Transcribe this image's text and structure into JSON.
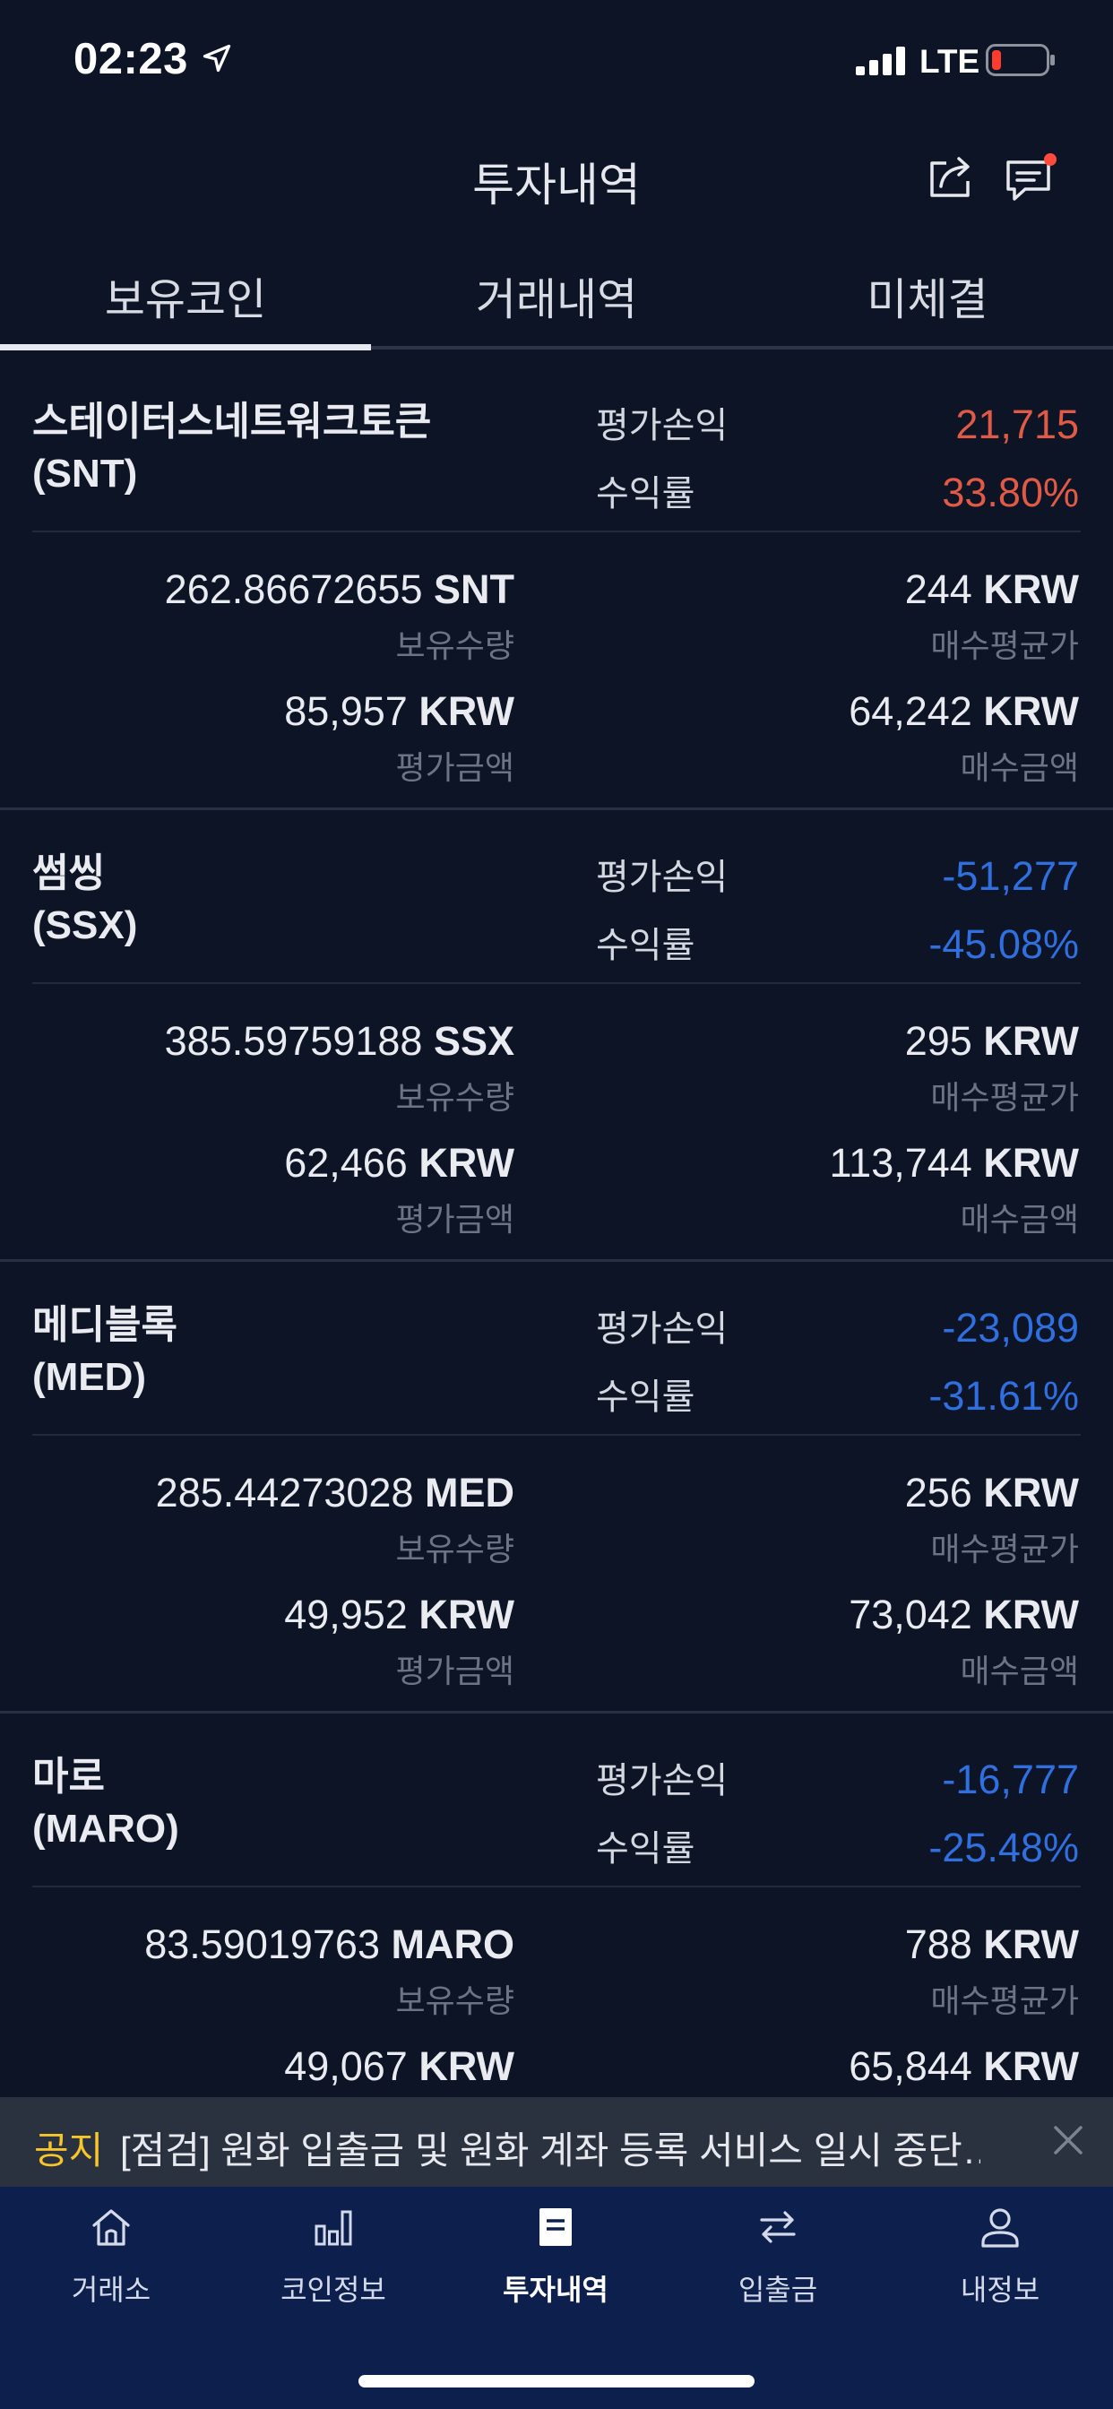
{
  "status": {
    "time": "02:23",
    "network": "LTE"
  },
  "header": {
    "title": "투자내역"
  },
  "tabs": [
    "보유코인",
    "거래내역",
    "미체결"
  ],
  "labels": {
    "pl": "평가손익",
    "rate": "수익률",
    "holdings": "보유수량",
    "avg_price": "매수평균가",
    "eval_amount": "평가금액",
    "buy_amount": "매수금액"
  },
  "coins": [
    {
      "name": "스테이터스네트워크토큰",
      "symbol": "(SNT)",
      "pl": "21,715",
      "rate": "33.80%",
      "qty": "262.86672655",
      "qty_unit": "SNT",
      "avg": "244",
      "avg_unit": "KRW",
      "eval": "85,957",
      "eval_unit": "KRW",
      "buy": "64,242",
      "buy_unit": "KRW"
    },
    {
      "name": "썸씽",
      "symbol": "(SSX)",
      "pl": "-51,277",
      "rate": "-45.08%",
      "qty": "385.59759188",
      "qty_unit": "SSX",
      "avg": "295",
      "avg_unit": "KRW",
      "eval": "62,466",
      "eval_unit": "KRW",
      "buy": "113,744",
      "buy_unit": "KRW"
    },
    {
      "name": "메디블록",
      "symbol": "(MED)",
      "pl": "-23,089",
      "rate": "-31.61%",
      "qty": "285.44273028",
      "qty_unit": "MED",
      "avg": "256",
      "avg_unit": "KRW",
      "eval": "49,952",
      "eval_unit": "KRW",
      "buy": "73,042",
      "buy_unit": "KRW"
    },
    {
      "name": "마로",
      "symbol": "(MARO)",
      "pl": "-16,777",
      "rate": "-25.48%",
      "qty": "83.59019763",
      "qty_unit": "MARO",
      "avg": "788",
      "avg_unit": "KRW",
      "eval": "49,067",
      "eval_unit": "KRW",
      "buy": "65,844",
      "buy_unit": "KRW"
    }
  ],
  "notice": {
    "tag": "공지",
    "text": "[점검] 원화 입출금 및 원화 계좌 등록 서비스 일시 중단…"
  },
  "nav": [
    "거래소",
    "코인정보",
    "투자내역",
    "입출금",
    "내정보"
  ],
  "colors": {
    "background": "#0c1425",
    "positive": "#e05a45",
    "negative": "#2f6fe0",
    "nav_bg": "#0c1f4d",
    "notice_tag": "#f5c52b"
  }
}
